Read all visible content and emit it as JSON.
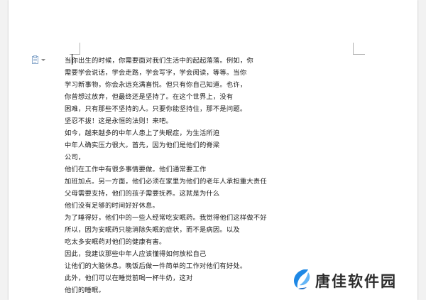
{
  "document": {
    "lines": [
      "当你出生的时候，你需要面对我们生活中的起起落落。例如，你",
      "需要学会说话，学会走路，学会写字，学会阅读，等等。当你",
      "学习新事物，你会永远充满喜悦。但只有你自己知道。也许，",
      "你曾想过放弃，但最终还是坚持了。在这个世界上，没有",
      "困难，只有那些不坚持的人。只要你能坚持住，那不是问题。",
      "坚忍不拔！这是永恒的法则！来吧。",
      "如今，越来越多的中年人患上了失眠症，为生活所迫",
      "中年人确实压力很大。首先，因为他们是他们的脊梁",
      "公司，",
      "他们在工作中有很多事情要做。他们通常要工作",
      "加班加点。另一方面，他们必须在家里为他们的老年人承担重大责任",
      "父母需要支持，他们的孩子需要抚养。这就是为什么",
      "他们没有足够的时间好好休息。",
      "为了睡得好，他们中的一些人经常吃安眠药。我觉得他们这样做不好",
      "所以，因为安眠药只能消除失眠的症状，而不是病因。以及",
      "吃太多安眠药对他们的健康有害。",
      "因此，我建议那些中年人应该懂得如何放松自己",
      "让他们的大脑休息。晚饭后做一件简单的工作对他们有好处。",
      "此外，他们可以在睡觉前喝一杯牛奶，这对",
      "他们的睡眠。"
    ]
  },
  "icons": {
    "paste_options": "paste-options-icon",
    "watermark_logo": "tangjia-logo-icon"
  },
  "watermark": {
    "text": "唐佳软件园"
  },
  "colors": {
    "page_background": "#ffffff",
    "app_background": "#f2f2f2",
    "text": "#1e1e1e",
    "logo_blue": "#1e88e5"
  }
}
